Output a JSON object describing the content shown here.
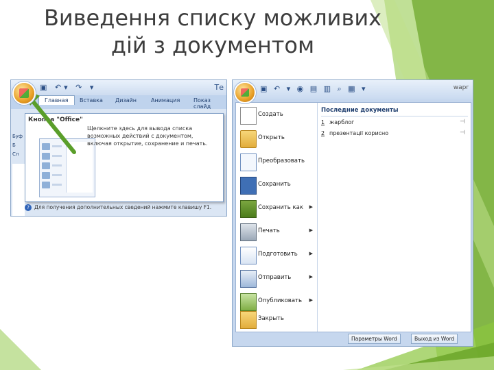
{
  "slide": {
    "title": "Виведення списку можливих дій з документом",
    "accent_color": "#8cc63f"
  },
  "left_window": {
    "tabs": [
      "Главная",
      "Вставка",
      "Дизайн",
      "Анимация",
      "Показ слайд"
    ],
    "title_fragment": "Те",
    "gutter_labels": [
      "Буф",
      "Б",
      "Сл"
    ],
    "tooltip": {
      "title": "Кнопка \"Office\"",
      "description": "Щелкните здесь для вывода списка возможных действий с документом, включая открытие, сохранение и печать."
    },
    "help_text": "Для получения дополнительных сведений нажмите клавишу F1."
  },
  "right_window": {
    "title_fragment": "wapr",
    "menu_items": [
      {
        "label": "Создать",
        "icon": "new-doc-icon",
        "submenu": false
      },
      {
        "label": "Открыть",
        "icon": "open-folder-icon",
        "submenu": false
      },
      {
        "label": "Преобразовать",
        "icon": "convert-icon",
        "submenu": false
      },
      {
        "label": "Сохранить",
        "icon": "save-icon",
        "submenu": false
      },
      {
        "label": "Сохранить как",
        "icon": "save-as-icon",
        "submenu": true
      },
      {
        "label": "Печать",
        "icon": "print-icon",
        "submenu": true
      },
      {
        "label": "Подготовить",
        "icon": "prepare-icon",
        "submenu": true
      },
      {
        "label": "Отправить",
        "icon": "send-icon",
        "submenu": true
      },
      {
        "label": "Опубликовать",
        "icon": "publish-icon",
        "submenu": true
      },
      {
        "label": "Закрыть",
        "icon": "close-folder-icon",
        "submenu": false
      }
    ],
    "recent": {
      "heading": "Последние документы",
      "items": [
        {
          "num": "1",
          "name": "жарблог"
        },
        {
          "num": "2",
          "name": "презентації корисно"
        }
      ]
    },
    "buttons": {
      "options": "Параметры Word",
      "exit": "Выход из Word"
    }
  }
}
